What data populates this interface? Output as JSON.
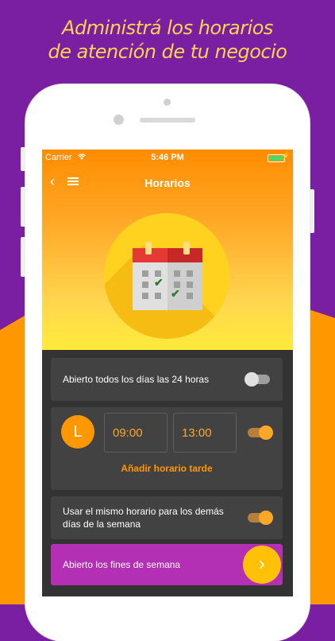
{
  "headline": {
    "line1": "Administrá los horarios",
    "line2": "de atención de tu negocio"
  },
  "status": {
    "carrier": "Carrier",
    "time": "5:46 PM"
  },
  "nav": {
    "title": "Horarios",
    "back_icon": "chevron-left-icon",
    "menu_icon": "hamburger-menu-icon"
  },
  "settings": {
    "open_24h": {
      "label": "Abierto todos los días las 24 horas",
      "enabled": false
    },
    "day_schedule": {
      "day_letter": "L",
      "open_time": "09:00",
      "close_time": "13:00",
      "enabled": true,
      "add_afternoon_label": "Añadir horario tarde"
    },
    "same_schedule": {
      "label_line1": "Usar el mismo horario para los demás",
      "label_line2": "días de la semana",
      "enabled": true
    },
    "weekend": {
      "label": "Abierto los fines de semana",
      "next_icon": "chevron-right-icon"
    }
  },
  "colors": {
    "brand_purple": "#7b1fa2",
    "accent_orange": "#ff9800",
    "headline_yellow": "#ffd54f",
    "weekend_magenta": "#b32fb3"
  }
}
